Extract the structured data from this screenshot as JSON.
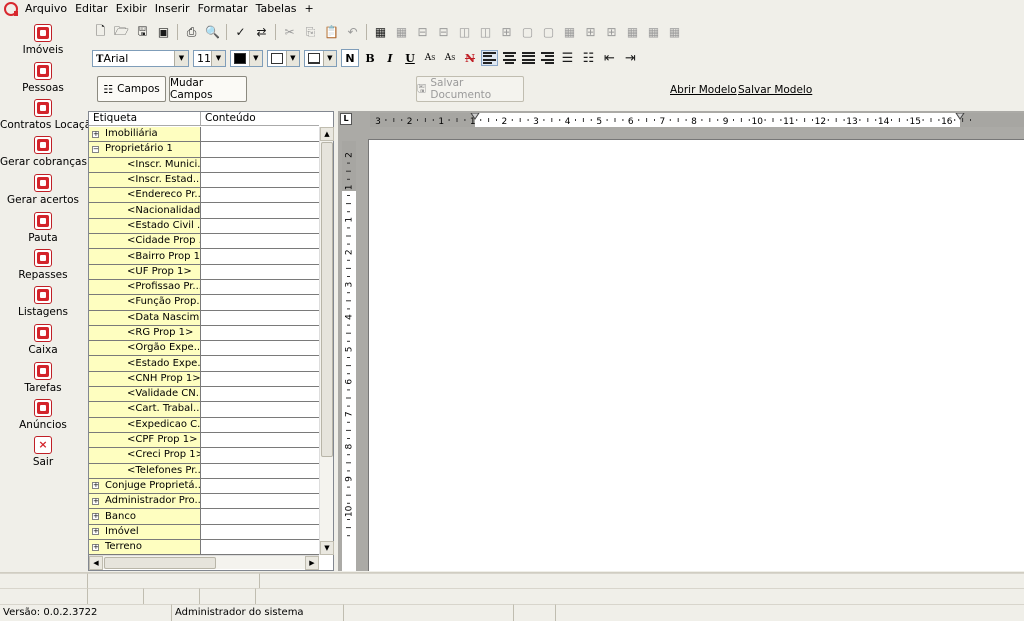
{
  "menu": {
    "items": [
      "Arquivo",
      "Editar",
      "Exibir",
      "Inserir",
      "Formatar",
      "Tabelas",
      "+"
    ]
  },
  "sidebar": {
    "items": [
      {
        "label": "Imóveis",
        "icon": "house-icon"
      },
      {
        "label": "Pessoas",
        "icon": "people-icon"
      },
      {
        "label": "Contratos Locação",
        "icon": "contract-icon"
      },
      {
        "label": "Gerar cobranças",
        "icon": "clip-icon"
      },
      {
        "label": "Gerar acertos",
        "icon": "dollar-icon"
      },
      {
        "label": "Pauta",
        "icon": "building-icon"
      },
      {
        "label": "Repasses",
        "icon": "transfer-icon"
      },
      {
        "label": "Listagens",
        "icon": "printer-icon"
      },
      {
        "label": "Caixa",
        "icon": "cashbox-icon"
      },
      {
        "label": "Tarefas",
        "icon": "tasks-icon"
      },
      {
        "label": "Anúncios",
        "icon": "announcement-icon"
      },
      {
        "label": "Sair",
        "icon": "exit-icon"
      }
    ]
  },
  "format": {
    "font": "Arial",
    "size": "11",
    "bold": "N",
    "bold_alt": "B",
    "italic": "I",
    "underline": "U"
  },
  "buttons": {
    "campos": "Campos",
    "mudar_campos": "Mudar Campos",
    "salvar_documento": "Salvar Documento",
    "abrir_modelo": "Abrir Modelo",
    "salvar_modelo": "Salvar Modelo"
  },
  "tree": {
    "col_etiqueta": "Etiqueta",
    "col_conteudo": "Conteúdo",
    "rows": [
      {
        "label": "Imobiliária",
        "expander": "+",
        "level": 0
      },
      {
        "label": "Proprietário 1",
        "expander": "−",
        "level": 0
      },
      {
        "label": "<Inscr. Munici...",
        "level": 1
      },
      {
        "label": "<Inscr. Estad...",
        "level": 1
      },
      {
        "label": "<Endereco Pr...",
        "level": 1
      },
      {
        "label": "<Nacionalidad...",
        "level": 1
      },
      {
        "label": "<Estado Civil ...",
        "level": 1
      },
      {
        "label": "<Cidade Prop ...",
        "level": 1
      },
      {
        "label": "<Bairro Prop 1>",
        "level": 1
      },
      {
        "label": "<UF Prop 1>",
        "level": 1
      },
      {
        "label": "<Profissao Pr...",
        "level": 1
      },
      {
        "label": "<Função Prop...",
        "level": 1
      },
      {
        "label": "<Data Nascim...",
        "level": 1
      },
      {
        "label": "<RG Prop 1>",
        "level": 1
      },
      {
        "label": "<Orgão Expe...",
        "level": 1
      },
      {
        "label": "<Estado Expe...",
        "level": 1
      },
      {
        "label": "<CNH Prop 1>",
        "level": 1
      },
      {
        "label": "<Validade CN...",
        "level": 1
      },
      {
        "label": "<Cart. Trabal...",
        "level": 1
      },
      {
        "label": "<Expedicao C...",
        "level": 1
      },
      {
        "label": "<CPF Prop 1>",
        "level": 1
      },
      {
        "label": "<Creci Prop 1>",
        "level": 1
      },
      {
        "label": "<Telefones Pr...",
        "level": 1
      },
      {
        "label": "Conjuge Proprietá...",
        "expander": "+",
        "level": 0
      },
      {
        "label": "Administrador Pro...",
        "expander": "+",
        "level": 0
      },
      {
        "label": "Banco",
        "expander": "+",
        "level": 0
      },
      {
        "label": "Imóvel",
        "expander": "+",
        "level": 0
      },
      {
        "label": "Terreno",
        "expander": "+",
        "level": 0
      }
    ]
  },
  "ruler": {
    "corner": "L",
    "h_labels": [
      "3",
      "2",
      "1",
      "1",
      "2",
      "3",
      "4",
      "5",
      "6",
      "7",
      "8",
      "9",
      "10",
      "11",
      "12",
      "13",
      "14",
      "15",
      "16"
    ],
    "v_labels": [
      "2",
      "1",
      "1",
      "2",
      "3",
      "4",
      "5",
      "6",
      "7",
      "8",
      "9",
      "10"
    ]
  },
  "status": {
    "version": "Versão: 0.0.2.3722",
    "user": "Administrador do sistema"
  },
  "colors": {
    "accent": "#d3242b",
    "tree_label_bg": "#fefec0",
    "editor_bg": "#abaaa6"
  }
}
